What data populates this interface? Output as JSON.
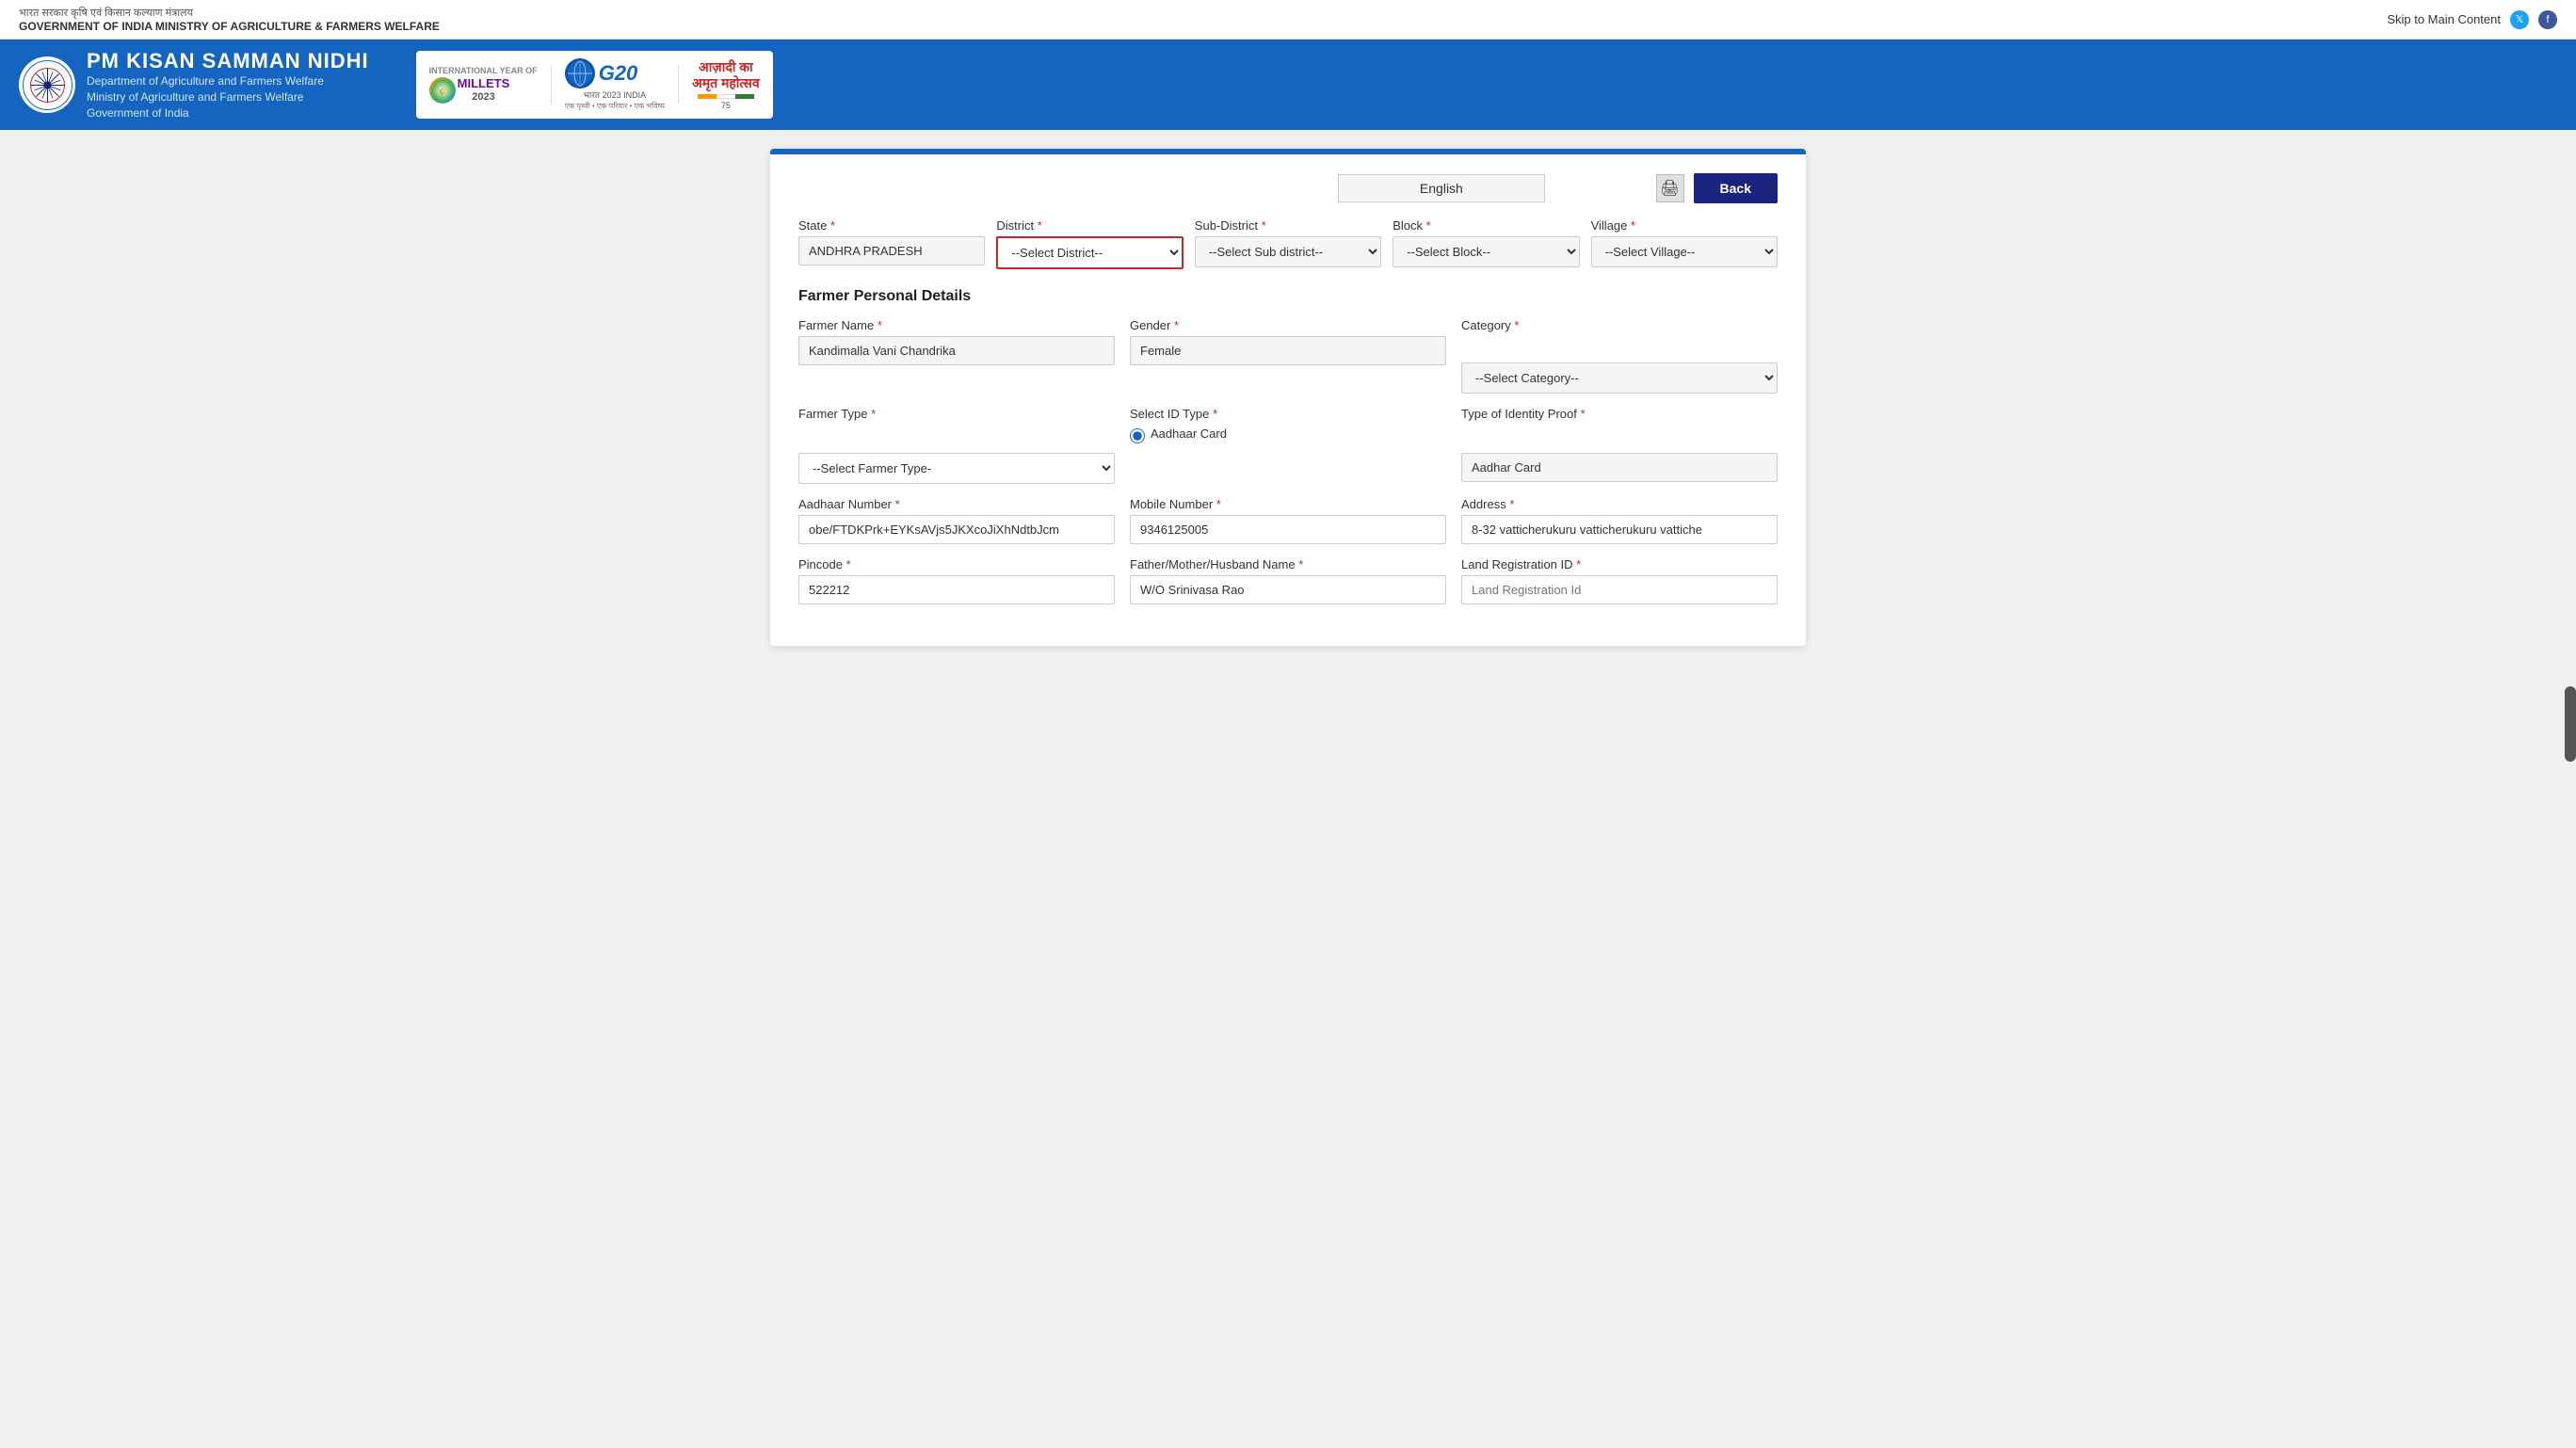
{
  "top_nav": {
    "hindi_text": "भारत सरकार   कृषि एवं किसान कल्याण मंत्रालय",
    "english_text": "GOVERNMENT OF INDIA   MINISTRY OF AGRICULTURE & FARMERS WELFARE",
    "skip_link": "Skip to Main Content"
  },
  "header": {
    "title": "PM KISAN SAMMAN NIDHI",
    "subtitle_line1": "Department of Agriculture and Farmers Welfare",
    "subtitle_line2": "Ministry of Agriculture and Farmers Welfare",
    "subtitle_line3": "Government of India",
    "logos": {
      "millets_label": "INTERNATIONAL YEAR OF",
      "millets_year": "MILLETS",
      "millets_year_num": "2023",
      "g20_label": "G20",
      "g20_sub": "भारत 2023 INDIA",
      "g20_sub2": "एक पृथ्वी • एक परिवार • एक भविष्य",
      "azadi_line1": "आज़ादी का",
      "azadi_line2": "अमृत महोत्सव"
    }
  },
  "form": {
    "language_value": "English",
    "back_button": "Back",
    "print_icon": "🖨",
    "location": {
      "state_label": "State",
      "state_value": "ANDHRA PRADESH",
      "district_label": "District",
      "district_placeholder": "--Select District--",
      "subdistrict_label": "Sub-District",
      "subdistrict_placeholder": "--Select Sub district--",
      "block_label": "Block",
      "block_placeholder": "--Select Block--",
      "village_label": "Village",
      "village_placeholder": "--Select Village--"
    },
    "section_title": "Farmer Personal Details",
    "farmer_name_label": "Farmer Name",
    "farmer_name_required": "*",
    "farmer_name_value": "Kandimalla Vani Chandrika",
    "gender_label": "Gender",
    "gender_required": "*",
    "gender_value": "Female",
    "category_label": "Category",
    "category_required": "*",
    "category_placeholder": "--Select Category--",
    "farmer_type_label": "Farmer Type",
    "farmer_type_required": "*",
    "farmer_type_placeholder": "--Select Farmer Type-",
    "id_type_label": "Select ID Type",
    "id_type_required": "*",
    "id_type_radio_label": "Aadhaar Card",
    "identity_proof_label": "Type of Identity Proof",
    "identity_proof_required": "*",
    "identity_proof_value": "Aadhar Card",
    "aadhaar_label": "Aadhaar Number",
    "aadhaar_required": "*",
    "aadhaar_value": "obe/FTDKPrk+EYKsAVjs5JKXcoJiXhNdtbJcm",
    "mobile_label": "Mobile Number",
    "mobile_required": "*",
    "mobile_value": "9346125005",
    "address_label": "Address",
    "address_required": "*",
    "address_value": "8-32 vatticherukuru vatticherukuru vattiche",
    "pincode_label": "Pincode",
    "pincode_required": "*",
    "pincode_value": "522212",
    "father_label": "Father/Mother/Husband Name",
    "father_required": "*",
    "father_value": "W/O Srinivasa Rao",
    "land_reg_label": "Land Registration ID",
    "land_reg_required": "*",
    "land_reg_placeholder": "Land Registration Id"
  }
}
